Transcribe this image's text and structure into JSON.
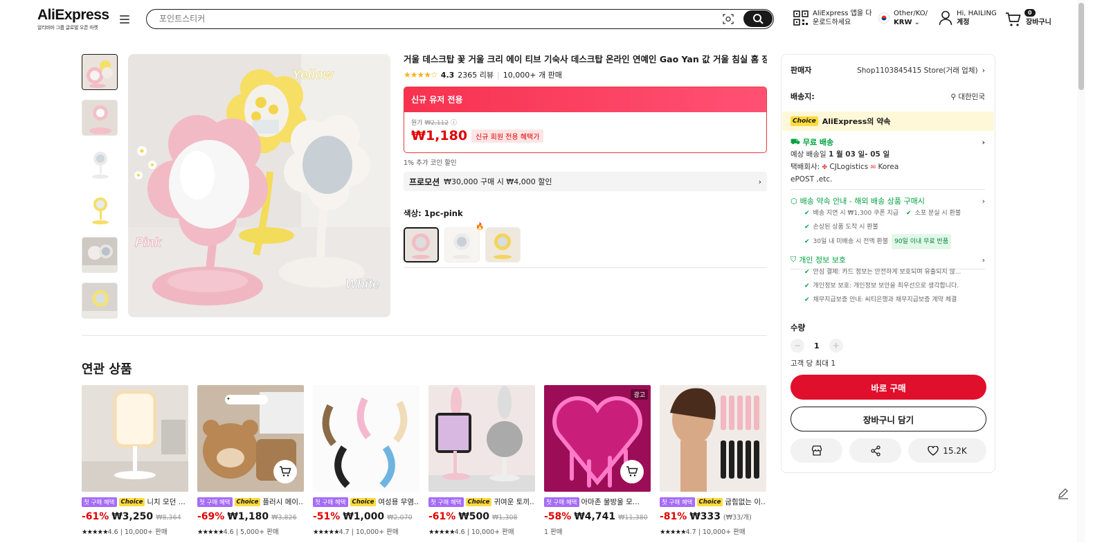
{
  "header": {
    "logo": "AliExpress",
    "logo_sub": "알리바바 그룹 글로벌 오픈 마켓",
    "search_placeholder": "포인트스티커",
    "app_line1": "AliExpress 앱을 다",
    "app_line2": "운로드하세요",
    "locale_line1": "Other/KO/",
    "locale_line2": "KRW",
    "account_line1": "Hi, HAILING",
    "account_line2": "계정",
    "cart_count": "0",
    "cart_label": "장바구니"
  },
  "product": {
    "title": "거울 데스크탑 꽃 거울 크리 에이 티브 기숙사 데스크탑 온라인 연예인 Gao Yan 값 거울 침실 홈 장식 거울",
    "stars": "★★★★☆",
    "rating": "4.3",
    "reviews": "2365 리뷰",
    "sold": "10,000+ 개 판매",
    "promo_head": "신규 유저 전용",
    "orig_label": "원가",
    "orig_price": "₩2,112",
    "price": "₩1,180",
    "price_badge": "신규 회원 전용 혜택가",
    "coin": "1% 추가 코인 할인",
    "promotion_label": "프로모션",
    "promotion_text": "₩30,000 구매 시 ₩4,000 할인",
    "color_label": "색상: 1pc-pink"
  },
  "panel": {
    "seller_label": "판매자",
    "seller_value": "Shop1103845415 Store(거래 업체)",
    "ship_to_label": "배송지:",
    "ship_to_value": "대한민국",
    "choice_tag": "Choice",
    "choice_text": "AliExpress의 약속",
    "free_ship": "무료 배송",
    "eta_prefix": "예상 배송일",
    "eta_value": "1 월 03 일- 05 일",
    "carrier_prefix": "택배회사:",
    "carrier1": "CJLogistics",
    "carrier2": "Korea",
    "carrier3": "ePOST ,etc.",
    "promise_head": "배송 약속 안내 - 해외 배송 상품 구매시",
    "promise1": "배송 지연 시 ₩1,300 쿠폰 지급",
    "promise2": "소포 분실 시 환불",
    "promise3": "손상된 상품 도착 시 환불",
    "promise4": "30일 내 미배송 시 전액 환불",
    "promise4_badge": "90일 이내 무료 반품",
    "privacy_head": "개인 정보 보호",
    "privacy1": "안심 결제: 카드 정보는 안전하게 보호되며 유출되지 않...",
    "privacy2": "개인정보 보호: 개인정보 보안을 최우선으로 생각합니다.",
    "privacy3": "채무지급보증 안내: 씨티은행과 채무지급보증 계약 체결",
    "qty_label": "수량",
    "qty_value": "1",
    "limit": "고객 당 최대 1",
    "buy_now": "바로 구매",
    "add_cart": "장바구니 담기",
    "wishlist_count": "15.2K"
  },
  "related": {
    "title": "연관 상품",
    "first_tag": "첫 구매 혜택",
    "choice_tag": "Choice",
    "ad_label": "광고",
    "items": [
      {
        "name": "니치 모던 ...",
        "discount": "-61%",
        "price": "₩3,250",
        "orig": "₩8,364",
        "unit": "",
        "meta": "4.6 | 10,000+ 판매",
        "stars": "★★★★★"
      },
      {
        "name": "플러시 메이...",
        "discount": "-69%",
        "price": "₩1,180",
        "orig": "₩3,826",
        "unit": "",
        "meta": "4.6 | 5,000+ 판매",
        "stars": "★★★★★"
      },
      {
        "name": "여성용 무염...",
        "discount": "-51%",
        "price": "₩1,000",
        "orig": "₩2,070",
        "unit": "",
        "meta": "4.7 | 10,000+ 판매",
        "stars": "★★★★★"
      },
      {
        "name": "귀여운 토끼...",
        "discount": "-61%",
        "price": "₩500",
        "orig": "₩1,308",
        "unit": "",
        "meta": "4.6 | 10,000+ 판매",
        "stars": "★★★★★"
      },
      {
        "name": "아마존 물방울 모...",
        "discount": "-58%",
        "price": "₩4,741",
        "orig": "₩11,380",
        "unit": "",
        "meta": "1 판매",
        "stars": ""
      },
      {
        "name": "굽힘없는 이...",
        "discount": "-81%",
        "price": "₩333",
        "orig": "",
        "unit": "(₩33/개)",
        "meta": "4.7 | 10,000+ 판매",
        "stars": "★★★★★"
      }
    ]
  }
}
